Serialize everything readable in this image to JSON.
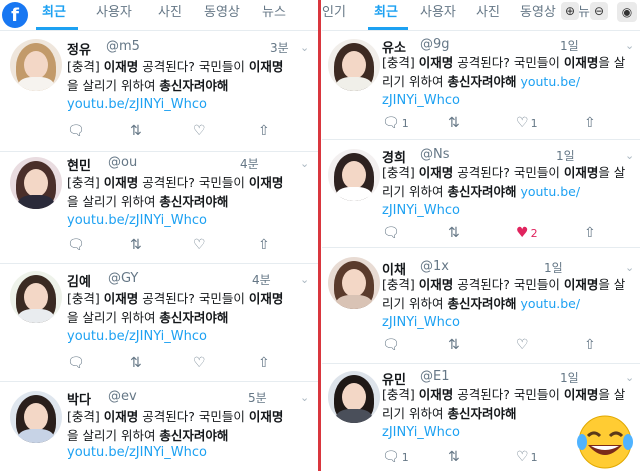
{
  "left": {
    "tabs": [
      "최근",
      "사용자",
      "사진",
      "동영상",
      "뉴스"
    ],
    "tweets": [
      {
        "name": "정유",
        "handle": "@m5",
        "time": "3분",
        "text_pre": "[충격] ",
        "text_b1": "이재명",
        "text_mid": " 공격된다? 국민들이 ",
        "text_b2": "이재명",
        "text_line2a": "을 살리기 위하여 ",
        "text_b3": "총신자려야해",
        "link": "youtu.be/zJINYi_Whco"
      },
      {
        "name": "현민",
        "handle": "@ou",
        "time": "4분",
        "text_pre": "[충격] ",
        "text_b1": "이재명",
        "text_mid": " 공격된다? 국민들이 ",
        "text_b2": "이재명",
        "text_line2a": "을 살리기 위하여 ",
        "text_b3": "총신자려야해",
        "link": "youtu.be/zJINYi_Whco"
      },
      {
        "name": "김예",
        "handle": "@GY",
        "time": "4분",
        "text_pre": "[충격] ",
        "text_b1": "이재명",
        "text_mid": " 공격된다? 국민들이 ",
        "text_b2": "이재명",
        "text_line2a": "을 살리기 위하여 ",
        "text_b3": "총신자려야해",
        "link": "youtu.be/zJINYi_Whco"
      },
      {
        "name": "박다",
        "handle": "@ev",
        "time": "5분",
        "text_pre": "[충격] ",
        "text_b1": "이재명",
        "text_mid": " 공격된다? 국민들이 ",
        "text_b2": "이재명",
        "text_line2a": "을 살리기 위하여 ",
        "text_b3": "총신자려야해",
        "link": "youtu.be/zJINYi_Whco"
      }
    ]
  },
  "right": {
    "tabs": [
      "인기",
      "최근",
      "사용자",
      "사진",
      "동영상",
      "뉴"
    ],
    "tweets": [
      {
        "name": "유소",
        "handle": "@9g",
        "time": "1일",
        "text_pre": "[충격] ",
        "text_b1": "이재명",
        "text_mid": " 공격된다? 국민들이 ",
        "text_b2": "이재명",
        "text_line2a": "을 살",
        "text_line2b": "리기 위하여 ",
        "text_b3": "총신자려야해",
        "link1": "youtu.be/",
        "link2": "zJINYi_Whco",
        "reply_count": "1",
        "like_count": "1"
      },
      {
        "name": "경희",
        "handle": "@Ns",
        "time": "1일",
        "text_pre": "[충격] ",
        "text_b1": "이재명",
        "text_mid": " 공격된다? 국민들이 ",
        "text_b2": "이재명",
        "text_line2a": "을 살",
        "text_line2b": "리기 위하여 ",
        "text_b3": "총신자려야해",
        "link1": "youtu.be/",
        "link2": "zJINYi_Whco",
        "like_count": "2"
      },
      {
        "name": "이채",
        "handle": "@1x",
        "time": "1일",
        "text_pre": "[충격] ",
        "text_b1": "이재명",
        "text_mid": " 공격된다? 국민들이 ",
        "text_b2": "이재명",
        "text_line2a": "을 살",
        "text_line2b": "리기 위하여 ",
        "text_b3": "총신자려야해",
        "link1": "youtu.be/",
        "link2": "zJINYi_Whco"
      },
      {
        "name": "유민",
        "handle": "@E1",
        "time": "1일",
        "text_pre": "[충격] ",
        "text_b1": "이재명",
        "text_mid": " 공격된다? 국민들이 ",
        "text_b2": "이재명",
        "text_line2a": "을 살",
        "text_line2b": "리기 위하여 ",
        "text_b3": "총신자려야해",
        "link1": "youtu.be/",
        "link2": "zJINYi_Whco",
        "reply_count": "1",
        "like_count": "1"
      }
    ]
  }
}
